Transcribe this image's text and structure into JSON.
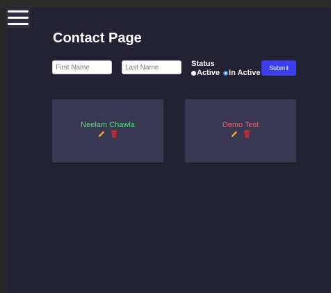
{
  "header": {
    "menu_icon": "hamburger-menu-icon",
    "title": "Contact Page"
  },
  "form": {
    "first_name": {
      "value": "",
      "placeholder": "First Name"
    },
    "last_name": {
      "value": "",
      "placeholder": "Last Name"
    },
    "status": {
      "label": "Status",
      "options": [
        {
          "label": "Active",
          "checked": false
        },
        {
          "label": "In Active",
          "checked": true
        }
      ]
    },
    "submit_label": "Submit"
  },
  "contacts": [
    {
      "name": "Neelam Chawla",
      "status": "active",
      "name_color": "#4ade80"
    },
    {
      "name": "Demo Test",
      "status": "inactive",
      "name_color": "#f05a6e"
    }
  ],
  "icons": {
    "edit": "pencil-icon",
    "delete": "trash-icon"
  },
  "colors": {
    "background": "#232233",
    "card": "#393853",
    "accent": "#3b3ff0",
    "edit_icon": "#f5a623",
    "delete_icon": "#d62828"
  }
}
